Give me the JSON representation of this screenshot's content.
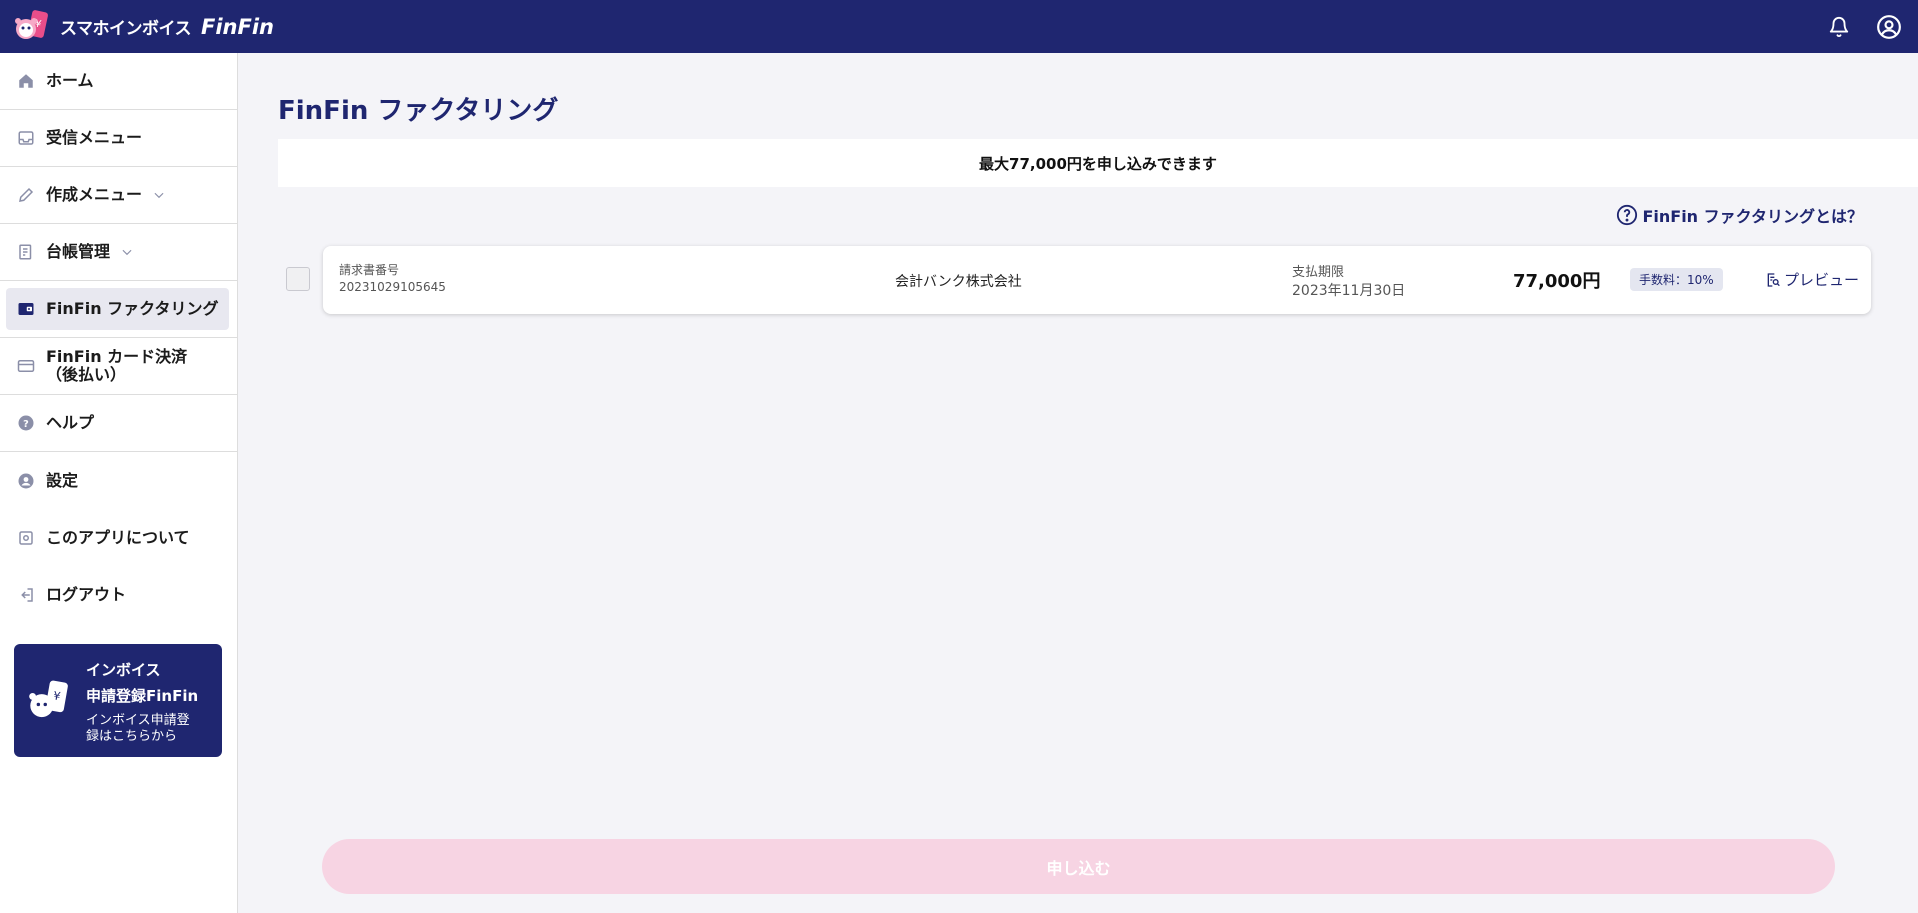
{
  "header": {
    "brand_jp": "スマホインボイス",
    "brand_en": "FinFin"
  },
  "sidebar": {
    "items": [
      {
        "label": "ホーム",
        "icon": "home-icon"
      },
      {
        "label": "受信メニュー",
        "icon": "inbox-icon"
      },
      {
        "label": "作成メニュー",
        "icon": "pencil-icon"
      },
      {
        "label": "台帳管理",
        "icon": "ledger-icon"
      },
      {
        "label": "FinFin ファクタリング",
        "icon": "wallet-icon"
      },
      {
        "label_line1": "FinFin カード決済",
        "label_line2": "（後払い）",
        "icon": "card-icon"
      },
      {
        "label": "ヘルプ",
        "icon": "help-icon"
      },
      {
        "label": "設定",
        "icon": "user-icon"
      },
      {
        "label": "このアプリについて",
        "icon": "gear-icon"
      },
      {
        "label": "ログアウト",
        "icon": "logout-icon"
      }
    ],
    "promo": {
      "title_line1": "インボイス",
      "title_line2": "申請登録FinFin",
      "desc_line1": "インボイス申請登",
      "desc_line2": "録はこちらから"
    }
  },
  "main": {
    "title": "FinFin ファクタリング",
    "limit_text": "最大77,000円を申し込みできます",
    "help_link": "FinFin ファクタリングとは？",
    "invoice": {
      "number_label": "請求書番号",
      "number": "20231029105645",
      "company": "会計バンク株式会社",
      "due_label": "支払期限",
      "due_date": "2023年11月30日",
      "amount": "77,000円",
      "fee": "手数料：10%",
      "preview_label": "プレビュー"
    },
    "apply_button": "申し込む"
  },
  "colors": {
    "navy": "#1f2670",
    "apply_disabled": "#f7d4e3",
    "background": "#f4f4f8"
  }
}
